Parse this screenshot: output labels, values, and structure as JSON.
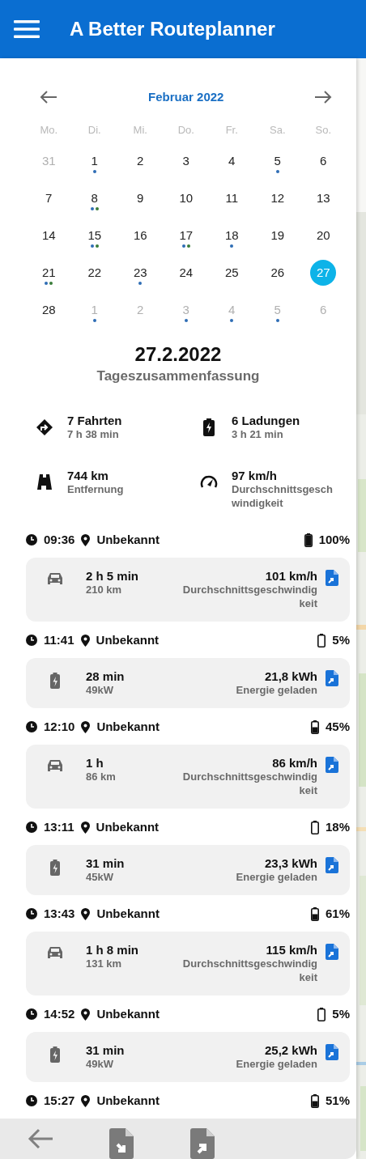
{
  "header": {
    "title": "A Better Routeplanner"
  },
  "calendar": {
    "month_label": "Februar 2022",
    "weekdays": [
      "Mo.",
      "Di.",
      "Mi.",
      "Do.",
      "Fr.",
      "Sa.",
      "So."
    ],
    "days": [
      {
        "label": "31",
        "muted": true,
        "selected": false
      },
      {
        "label": "1",
        "muted": false,
        "selected": false,
        "dots": [
          {
            "color": "#2f6db5"
          }
        ]
      },
      {
        "label": "2",
        "muted": false,
        "selected": false
      },
      {
        "label": "3",
        "muted": false,
        "selected": false
      },
      {
        "label": "4",
        "muted": false,
        "selected": false
      },
      {
        "label": "5",
        "muted": false,
        "selected": false,
        "dots": [
          {
            "color": "#2f6db5"
          }
        ]
      },
      {
        "label": "6",
        "muted": false,
        "selected": false
      },
      {
        "label": "7",
        "muted": false,
        "selected": false
      },
      {
        "label": "8",
        "muted": false,
        "selected": false,
        "dots": [
          {
            "color": "#2f6db5"
          },
          {
            "color": "#3a7d3a"
          }
        ]
      },
      {
        "label": "9",
        "muted": false,
        "selected": false
      },
      {
        "label": "10",
        "muted": false,
        "selected": false
      },
      {
        "label": "11",
        "muted": false,
        "selected": false
      },
      {
        "label": "12",
        "muted": false,
        "selected": false
      },
      {
        "label": "13",
        "muted": false,
        "selected": false
      },
      {
        "label": "14",
        "muted": false,
        "selected": false
      },
      {
        "label": "15",
        "muted": false,
        "selected": false,
        "dots": [
          {
            "color": "#2f6db5"
          },
          {
            "color": "#3a7d3a"
          }
        ]
      },
      {
        "label": "16",
        "muted": false,
        "selected": false
      },
      {
        "label": "17",
        "muted": false,
        "selected": false,
        "dots": [
          {
            "color": "#2f6db5"
          },
          {
            "color": "#3a7d3a"
          }
        ]
      },
      {
        "label": "18",
        "muted": false,
        "selected": false,
        "dots": [
          {
            "color": "#2f6db5"
          }
        ]
      },
      {
        "label": "19",
        "muted": false,
        "selected": false
      },
      {
        "label": "20",
        "muted": false,
        "selected": false
      },
      {
        "label": "21",
        "muted": false,
        "selected": false,
        "dots": [
          {
            "color": "#2f6db5"
          },
          {
            "color": "#3a7d3a"
          }
        ]
      },
      {
        "label": "22",
        "muted": false,
        "selected": false
      },
      {
        "label": "23",
        "muted": false,
        "selected": false,
        "dots": [
          {
            "color": "#2f6db5"
          }
        ]
      },
      {
        "label": "24",
        "muted": false,
        "selected": false
      },
      {
        "label": "25",
        "muted": false,
        "selected": false
      },
      {
        "label": "26",
        "muted": false,
        "selected": false
      },
      {
        "label": "27",
        "muted": false,
        "selected": true
      },
      {
        "label": "28",
        "muted": false,
        "selected": false
      },
      {
        "label": "1",
        "muted": true,
        "selected": false,
        "dots": [
          {
            "color": "#2f6db5"
          }
        ]
      },
      {
        "label": "2",
        "muted": true,
        "selected": false
      },
      {
        "label": "3",
        "muted": true,
        "selected": false,
        "dots": [
          {
            "color": "#2f6db5"
          }
        ]
      },
      {
        "label": "4",
        "muted": true,
        "selected": false,
        "dots": [
          {
            "color": "#2f6db5"
          }
        ]
      },
      {
        "label": "5",
        "muted": true,
        "selected": false,
        "dots": [
          {
            "color": "#2f6db5"
          }
        ]
      },
      {
        "label": "6",
        "muted": true,
        "selected": false
      }
    ]
  },
  "summary": {
    "date": "27.2.2022",
    "subtitle": "Tageszusammenfassung",
    "stats": [
      {
        "kind": "trips",
        "value": "7 Fahrten",
        "label": "7 h 38 min"
      },
      {
        "kind": "charges",
        "value": "6 Ladungen",
        "label": "3 h 21 min"
      },
      {
        "kind": "distance",
        "value": "744 km",
        "label": "Entfernung"
      },
      {
        "kind": "speed",
        "value": "97 km/h",
        "label": "Durchschnittsgeschwindigkeit"
      }
    ]
  },
  "timeline": [
    {
      "kind": "stop",
      "time": "09:36",
      "place": "Unbekannt",
      "battery": {
        "text": "100%",
        "kind": "full"
      }
    },
    {
      "kind": "drive",
      "duration": "2 h 5 min",
      "detail": "210 km",
      "value": "101 km/h",
      "value_label": "Durchschnittsgeschwindigkeit"
    },
    {
      "kind": "stop",
      "time": "11:41",
      "place": "Unbekannt",
      "battery": {
        "text": "5%",
        "kind": "empty"
      }
    },
    {
      "kind": "charge",
      "duration": "28 min",
      "detail": "49kW",
      "value": "21,8 kWh",
      "value_label": "Energie geladen"
    },
    {
      "kind": "stop",
      "time": "12:10",
      "place": "Unbekannt",
      "battery": {
        "text": "45%",
        "kind": "half"
      }
    },
    {
      "kind": "drive",
      "duration": "1 h",
      "detail": "86 km",
      "value": "86 km/h",
      "value_label": "Durchschnittsgeschwindigkeit"
    },
    {
      "kind": "stop",
      "time": "13:11",
      "place": "Unbekannt",
      "battery": {
        "text": "18%",
        "kind": "empty"
      }
    },
    {
      "kind": "charge",
      "duration": "31 min",
      "detail": "45kW",
      "value": "23,3 kWh",
      "value_label": "Energie geladen"
    },
    {
      "kind": "stop",
      "time": "13:43",
      "place": "Unbekannt",
      "battery": {
        "text": "61%",
        "kind": "half"
      }
    },
    {
      "kind": "drive",
      "duration": "1 h 8 min",
      "detail": "131 km",
      "value": "115 km/h",
      "value_label": "Durchschnittsgeschwindigkeit"
    },
    {
      "kind": "stop",
      "time": "14:52",
      "place": "Unbekannt",
      "battery": {
        "text": "5%",
        "kind": "empty"
      }
    },
    {
      "kind": "charge",
      "duration": "31 min",
      "detail": "49kW",
      "value": "25,2 kWh",
      "value_label": "Energie geladen"
    },
    {
      "kind": "stop",
      "time": "15:27",
      "place": "Unbekannt",
      "battery": {
        "text": "51%",
        "kind": "half"
      }
    }
  ],
  "toolbar": {
    "buttons": [
      {
        "kind": "back"
      },
      {
        "kind": "import"
      },
      {
        "kind": "export"
      }
    ]
  }
}
